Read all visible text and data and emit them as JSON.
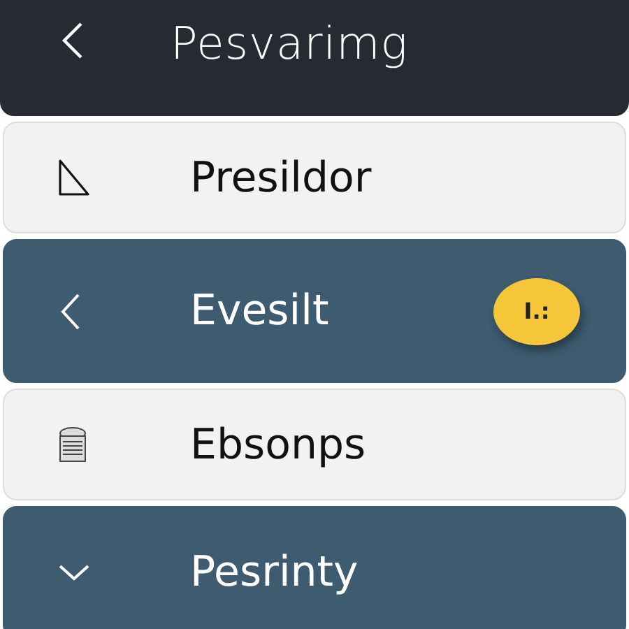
{
  "header": {
    "title": "Pesvarimg"
  },
  "items": [
    {
      "label": "Presildor",
      "selected": false
    },
    {
      "label": "Evesilt",
      "selected": true,
      "badge": "I.:"
    },
    {
      "label": "Ebsonps",
      "selected": false
    },
    {
      "label": "Pesrinty",
      "selected": true
    }
  ]
}
